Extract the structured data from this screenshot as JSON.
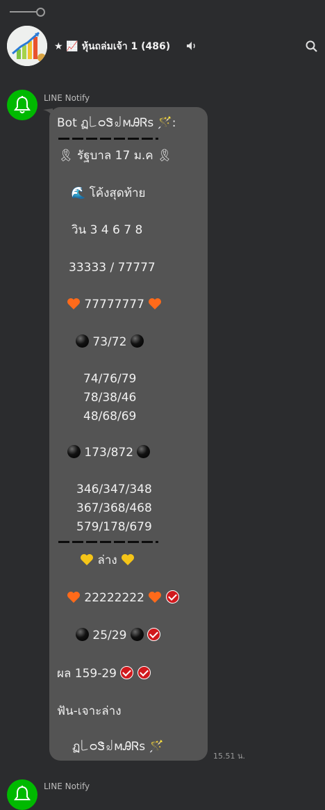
{
  "header": {
    "group_title": "★ 📈 หุ้นถล่มเจ้า 1 (486)"
  },
  "messages": [
    {
      "sender": "LINE Notify",
      "lines": [
        "Bot  ฏ꒒ᴑᏕ꒻ᴍᎯᏒs 🪄:",
        "🎗 รัฐบาล 17 ม.ค 🎗",
        "🌊 โค้งสุดท้าย",
        "วิน  3 4 6 7 8",
        "33333 / 77777",
        "77777777",
        "73/72",
        "74/76/79",
        "78/38/46",
        "48/68/69",
        "173/872",
        "346/347/348",
        "367/368/468",
        "579/178/679",
        "ล่าง",
        "22222222",
        "25/29",
        "ผล 159-29",
        "ฟัน-เจาะล่าง",
        "ฏ꒒ᴑᏕ꒻ᴍᎯᏒs 🪄"
      ],
      "time": "15.51 น."
    },
    {
      "sender": "LINE Notify"
    }
  ],
  "colors": {
    "background": "#2b2c2e",
    "bubble": "#545454",
    "notify_green": "#00b900",
    "check_red": "#d0191d",
    "heart_orange": "#ff6a1a",
    "heart_yellow": "#f5c518"
  },
  "icons": [
    "slider-icon",
    "speaker-icon",
    "search-icon",
    "bell-icon",
    "ribbon-icon",
    "wave-icon",
    "heart-icon",
    "black-circle-icon",
    "check-icon",
    "wand-icon"
  ]
}
